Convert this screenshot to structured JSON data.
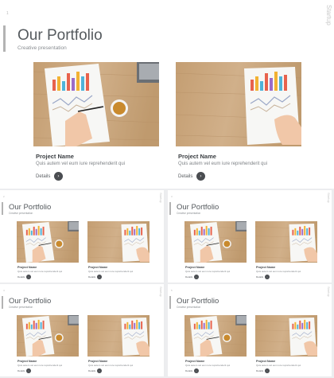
{
  "slides": [
    {
      "slide_number": "1",
      "side_label": "Startup",
      "title": "Our Portfolio",
      "subtitle": "Creative  presentation",
      "projects": [
        {
          "name": "Project Name",
          "description": "Quis  autem  vel eum  iure  reprehenderit   qui",
          "details_label": "Details",
          "details_icon": "chevron-right-icon"
        },
        {
          "name": "Project Name",
          "description": "Quis  autem  vel eum  iure  reprehenderit   qui",
          "details_label": "Details",
          "details_icon": "chevron-right-icon"
        }
      ]
    },
    {
      "slide_number": "2",
      "side_label": "Startup",
      "title": "Our Portfolio",
      "subtitle": "Creative  presentation",
      "projects": [
        {
          "name": "Project Name",
          "description": "Quis  autem  vel eum  iure  reprehenderit   qui",
          "details_label": "Details"
        },
        {
          "name": "Project Name",
          "description": "Quis  autem  vel eum  iure  reprehenderit   qui",
          "details_label": "Details"
        }
      ]
    },
    {
      "slide_number": "3",
      "side_label": "Startup",
      "title": "Our Portfolio",
      "subtitle": "Creative  presentation",
      "projects": [
        {
          "name": "Project Name",
          "description": "Quis  autem  vel eum  iure  reprehenderit   qui",
          "details_label": "Details"
        },
        {
          "name": "Project Name",
          "description": "Quis  autem  vel eum  iure  reprehenderit   qui",
          "details_label": "Details"
        }
      ]
    },
    {
      "slide_number": "4",
      "side_label": "Startup",
      "title": "Our Portfolio",
      "subtitle": "Creative  presentation",
      "projects": [
        {
          "name": "Project Name",
          "description": "Quis  autem  vel eum  iure  reprehenderit   qui",
          "details_label": "Details"
        },
        {
          "name": "Project Name",
          "description": "Quis  autem  vel eum  iure  reprehenderit   qui",
          "details_label": "Details"
        }
      ]
    },
    {
      "slide_number": "5",
      "side_label": "Startup",
      "title": "Our Portfolio",
      "subtitle": "Creative  presentation",
      "projects": [
        {
          "name": "Project Name",
          "description": "Quis  autem  vel eum  iure  reprehenderit   qui",
          "details_label": "Details"
        },
        {
          "name": "Project Name",
          "description": "Quis  autem  vel eum  iure  reprehenderit   qui",
          "details_label": "Details"
        }
      ]
    }
  ],
  "colors": {
    "accent_bar": "#b3b3b3",
    "title_text": "#555a5e",
    "details_button": "#4a4d51",
    "wood": "#c9a77c"
  }
}
